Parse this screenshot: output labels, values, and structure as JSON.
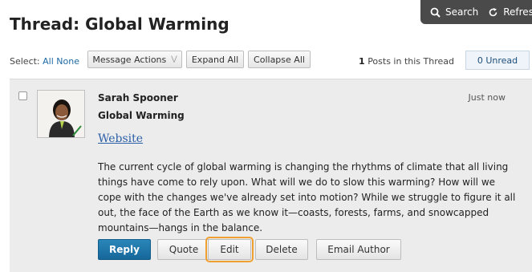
{
  "header": {
    "title": "Thread: Global Warming",
    "tools": [
      {
        "label": "Search",
        "icon": "search-icon"
      },
      {
        "label": "Refresh",
        "icon": "refresh-icon"
      }
    ]
  },
  "toolbar": {
    "select_label": "Select:",
    "select_all": "All",
    "select_none": "None",
    "message_actions": "Message Actions",
    "expand_all": "Expand All",
    "collapse_all": "Collapse All",
    "post_count": "1",
    "post_count_label": "Posts in this Thread",
    "unread": "0 Unread"
  },
  "post": {
    "author": "Sarah Spooner",
    "subject": "Global Warming",
    "timestamp": "Just now",
    "link": "Website",
    "body": "The current cycle of global warming is changing the rhythms of climate that all living things have come to rely upon. What will we do to slow this warming? How will we cope with the changes we've already set into motion? While we struggle to figure it all out, the face of the Earth as we know it—coasts, forests, farms, and snowcapped mountains—hangs in the balance.",
    "actions": {
      "reply": "Reply",
      "quote": "Quote",
      "edit": "Edit",
      "delete": "Delete",
      "email_author": "Email Author"
    }
  },
  "colors": {
    "primary_button": "#1c72a8",
    "focus_outline": "#f0a030",
    "link": "#2b5fa8",
    "post_background": "#ececec",
    "tools_bar": "#4a4a4a"
  }
}
